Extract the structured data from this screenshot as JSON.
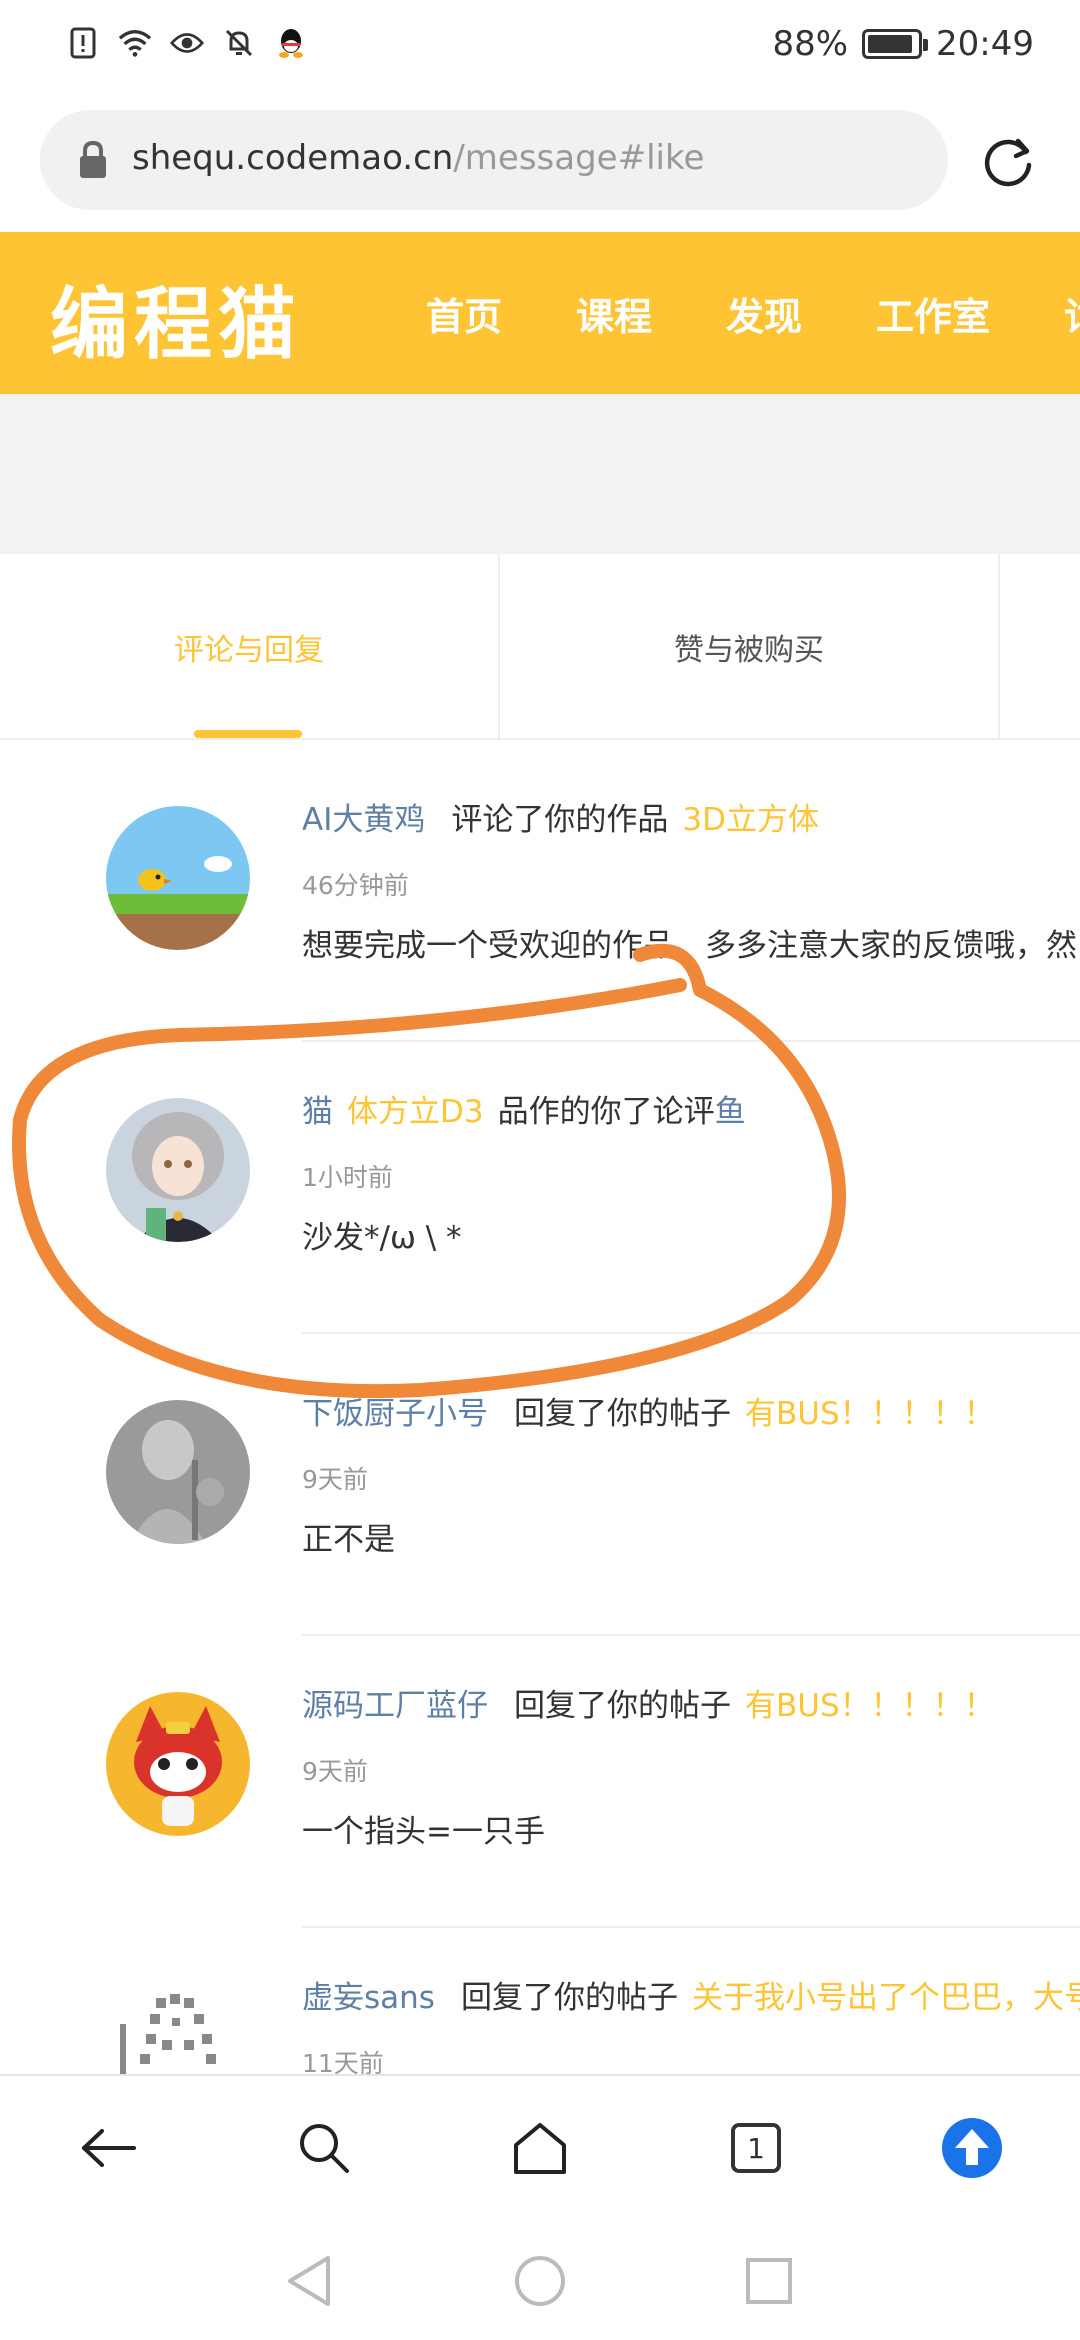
{
  "status_bar": {
    "battery_percent": "88%",
    "battery_level": 0.88,
    "time": "20:49",
    "icons": [
      "alert-sim-icon",
      "wifi-icon",
      "eye-icon",
      "mute-icon",
      "qq-icon"
    ]
  },
  "browser": {
    "url_host": "shequ.codemao.cn",
    "url_path": "/message#like"
  },
  "site": {
    "logo": "编程猫",
    "nav": [
      "首页",
      "课程",
      "发现",
      "工作室",
      "讨"
    ]
  },
  "tabs": [
    {
      "label": "评论与回复",
      "active": true
    },
    {
      "label": "赞与被购买",
      "active": false
    }
  ],
  "messages": [
    {
      "user": "AI大黄鸡",
      "action": "评论了你的作品",
      "target": "3D立方体",
      "time": "46分钟前",
      "body": "想要完成一个受欢迎的作品，多多注意大家的反馈哦，然"
    },
    {
      "user": "猫",
      "action": "品作的你了论评",
      "target": "体方立D3",
      "user_suffix": "鱼",
      "time": "1小时前",
      "body": "沙发*/ω \\ *"
    },
    {
      "user": "下饭厨子小号",
      "action": "回复了你的帖子",
      "target": "有BUS！！！！！",
      "time": "9天前",
      "body": "正不是"
    },
    {
      "user": "源码工厂蓝仔",
      "action": "回复了你的帖子",
      "target": "有BUS！！！！！",
      "time": "9天前",
      "body": "一个指头=一只手"
    },
    {
      "user": "虚妄sans",
      "action": "回复了你的帖子",
      "target": "关于我小号出了个巴巴，大号",
      "time": "11天前",
      "body": ""
    }
  ],
  "bottom_bar": {
    "tab_count": "1",
    "icons": [
      "back-arrow-icon",
      "search-icon",
      "home-icon",
      "tabs-icon",
      "upload-icon"
    ]
  },
  "colors": {
    "brand": "#fec433",
    "user_link": "#5e7fa6",
    "annotation": "#f0883a",
    "upload_button": "#1a73e8"
  }
}
